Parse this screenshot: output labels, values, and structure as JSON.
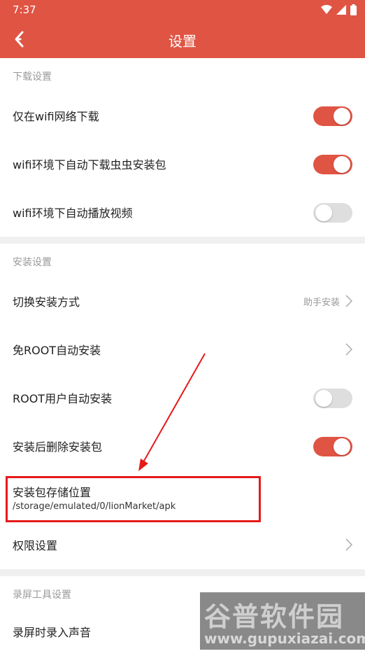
{
  "status_bar": {
    "time": "7:37"
  },
  "app_bar": {
    "title": "设置"
  },
  "sections": {
    "download": {
      "header": "下载设置",
      "items": [
        {
          "label": "仅在wifi网络下载",
          "toggle": "on"
        },
        {
          "label": "wifi环境下自动下载虫虫安装包",
          "toggle": "on"
        },
        {
          "label": "wifi环境下自动播放视频",
          "toggle": "off"
        }
      ]
    },
    "install": {
      "header": "安装设置",
      "items": [
        {
          "label": "切换安装方式",
          "value": "助手安装"
        },
        {
          "label": "免ROOT自动安装"
        },
        {
          "label": "ROOT用户自动安装",
          "toggle": "off"
        },
        {
          "label": "安装后删除安装包",
          "toggle": "on"
        },
        {
          "label": "安装包存储位置",
          "path": "/storage/emulated/0/lionMarket/apk"
        },
        {
          "label": "权限设置"
        }
      ]
    },
    "recording": {
      "header": "录屏工具设置",
      "items": [
        {
          "label": "录屏时录入声音"
        }
      ]
    }
  },
  "watermark": {
    "title": "谷普软件园",
    "url": "www.gupuxiazai.com"
  },
  "colors": {
    "accent": "#e05444",
    "annotation": "#e51a1a"
  }
}
